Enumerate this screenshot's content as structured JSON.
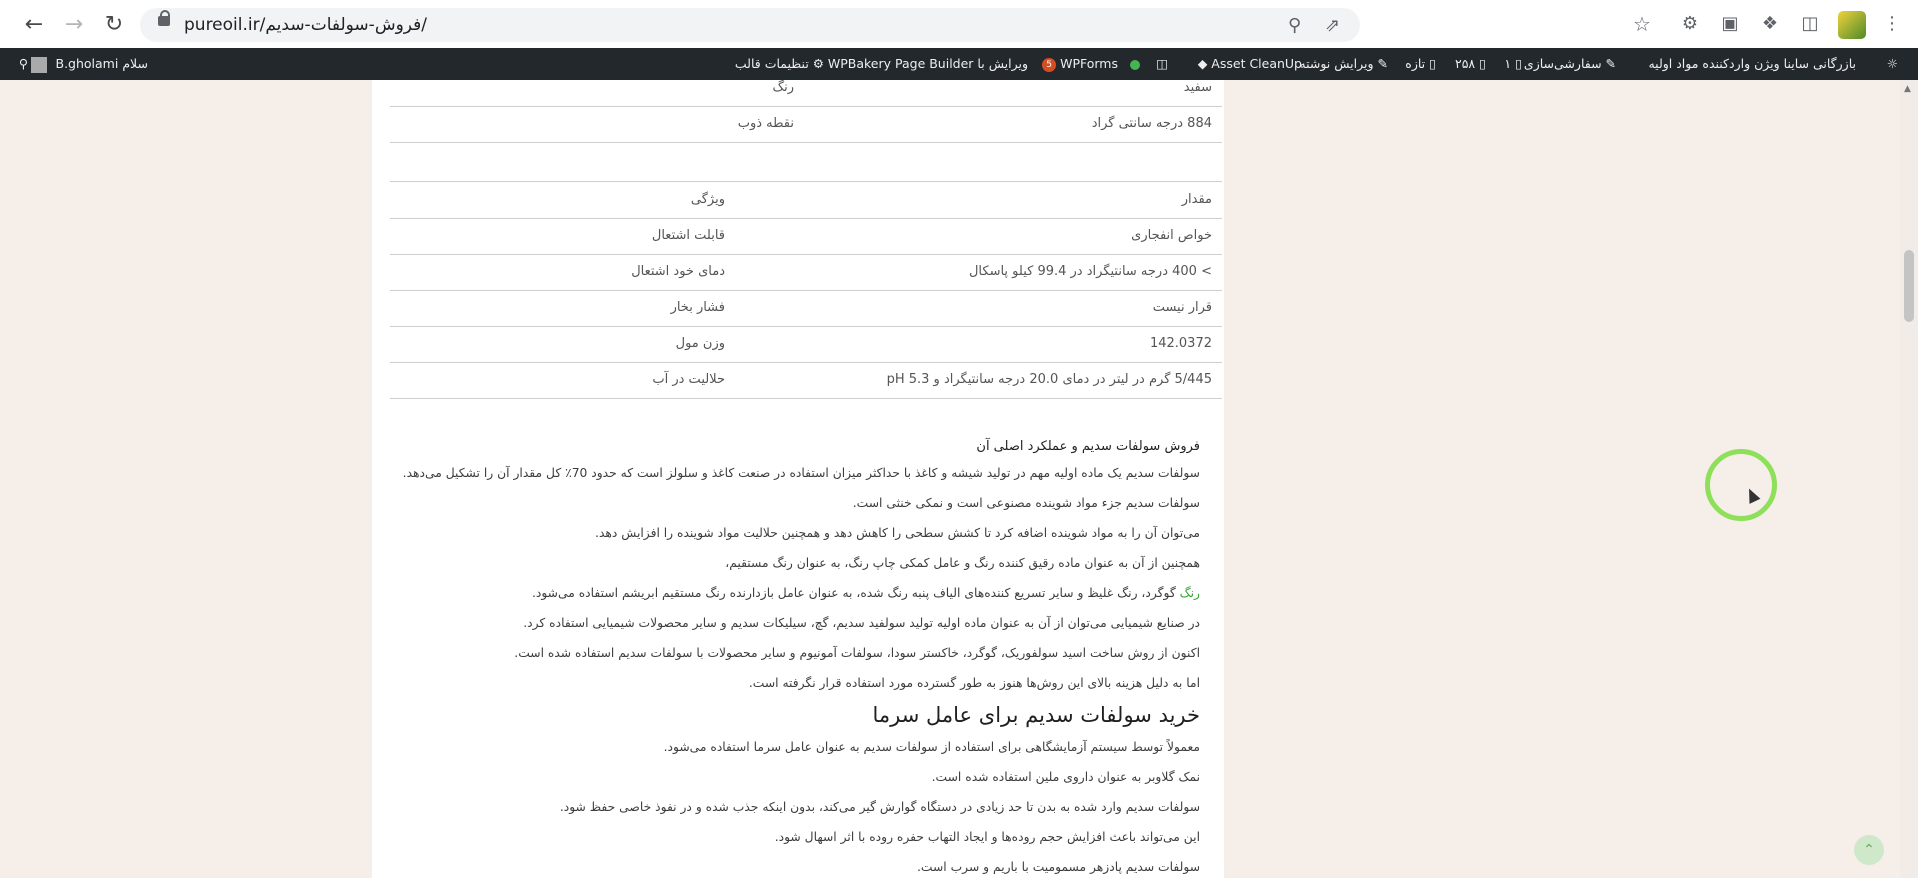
{
  "browser": {
    "url": "pureoil.ir/فروش-سولفات-سدیم/"
  },
  "admin_bar": {
    "site_name": "بازرگانی ساینا ویژن واردکننده مواد اولیه",
    "customize": "سفارشی‌سازی",
    "comments_count": "۱",
    "updates_count": "۲۵۸",
    "new": "تازه",
    "edit_post": "ویرایش نوشته",
    "asset_cleanup": "Asset CleanUp",
    "wpforms": "WPForms",
    "wpforms_badge": "5",
    "wpbakery": "ویرایش با WPBakery Page Builder",
    "theme_settings": "تنظیمات قالب",
    "greeting": "سلام B.gholami"
  },
  "table1": {
    "rows": [
      {
        "value": "سفید",
        "label": "رنگ"
      },
      {
        "value": "884 درجه سانتی گراد",
        "label": "نقطه ذوب"
      }
    ]
  },
  "table2": {
    "rows": [
      {
        "value": "مقدار",
        "label": "ویژگی"
      },
      {
        "value": "خواص انفجاری",
        "label": "قابلت اشتعال"
      },
      {
        "value": "> 400 درجه سانتیگراد در 99.4 کیلو پاسکال",
        "label": "دمای خود اشتعال"
      },
      {
        "value": "قرار نیست",
        "label": "فشار بخار"
      },
      {
        "value": "142.0372",
        "label": "وزن مول"
      },
      {
        "value": "5/445 گرم در لیتر در دمای 20.0 درجه سانتیگراد و pH 5.3",
        "label": "حلالیت در آب"
      }
    ]
  },
  "article": {
    "subheading": "فروش سولفات سدیم و عملکرد اصلی  آن",
    "p1": "سولفات سدیم یک ماده اولیه مهم در تولید شیشه و کاغذ با حداکثر میزان استفاده در صنعت کاغذ و سلولز است که حدود 70٪ کل مقدار آن را تشکیل می‌دهد.",
    "p2": "سولفات سدیم جزء مواد شوینده مصنوعی است و نمکی خنثی است.",
    "p3": "می‌توان آن را به مواد شوینده اضافه کرد تا کشش سطحی را کاهش دهد و همچنین حلالیت مواد شوینده را افزایش دهد.",
    "p4": "همچنین از آن به عنوان ماده رقیق کننده رنگ و عامل کمکی چاپ رنگ، به عنوان رنگ مستقیم،",
    "p5_link": "رنگ",
    "p5_rest": " گوگرد، رنگ غلیظ و سایر تسریع کننده‌های الیاف پنبه رنگ شده، به عنوان عامل بازدارنده رنگ مستقیم ابریشم استفاده می‌شود.",
    "p6": "در صنایع شیمیایی می‌توان از آن به عنوان ماده اولیه تولید سولفید سدیم، گچ، سیلیکات سدیم و سایر محصولات شیمیایی استفاده کرد.",
    "p7": "اکنون از روش ساخت اسید سولفوریک، گوگرد، خاکستر سودا، سولفات آمونیوم و سایر محصولات با سولفات سدیم استفاده شده است.",
    "p8": "اما به دلیل هزینه بالای این روش‌ها هنوز به طور گسترده مورد استفاده قرار نگرفته است.",
    "h2": "خرید سولفات سدیم برای عامل سرما",
    "p9": "معمولاً توسط سیستم آزمایشگاهی برای استفاده از سولفات سدیم به عنوان عامل سرما استفاده می‌شود.",
    "p10": "نمک گلاوبر به عنوان داروی ملین استفاده شده است.",
    "p11": "سولفات سدیم وارد شده به بدن تا حد زیادی در دستگاه گوارش گیر می‌کند، بدون اینکه جذب شده و در نفوذ خاصی حفظ شود.",
    "p12": "این می‌تواند باعث افزایش حجم روده‌ها و ایجاد التهاب حفره روده با اثر اسهال شود.",
    "p13": "سولفات سدیم پادزهر مسمومیت با باریم و سرب است."
  }
}
